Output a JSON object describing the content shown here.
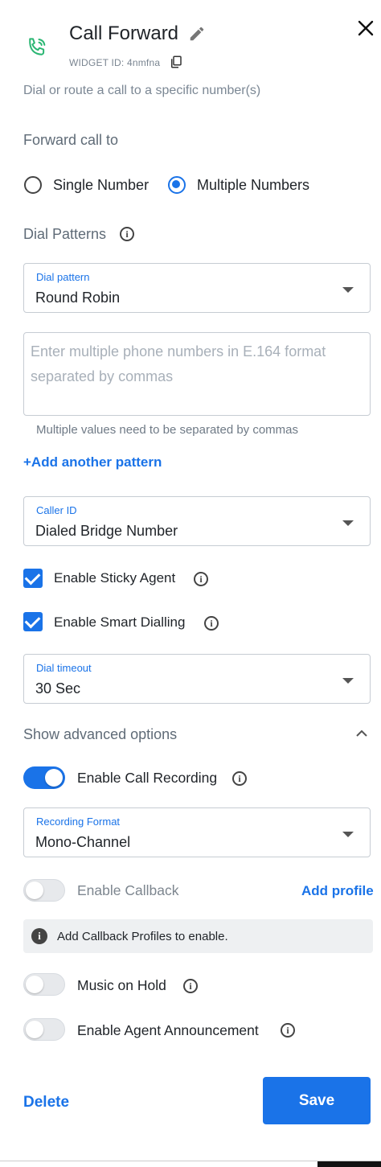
{
  "header": {
    "title": "Call Forward",
    "widget_id": "WIDGET ID: 4nmfna",
    "description": "Dial or route a call to a specific number(s)"
  },
  "forward": {
    "heading": "Forward call to",
    "options": [
      "Single Number",
      "Multiple Numbers"
    ],
    "selected": "Multiple Numbers"
  },
  "dial_patterns": {
    "heading": "Dial Patterns",
    "pattern_label": "Dial pattern",
    "pattern_value": "Round Robin",
    "numbers_placeholder": "Enter multiple phone numbers in E.164 format separated by commas",
    "helper": "Multiple values need to be separated by commas",
    "add_link": "+Add another pattern"
  },
  "caller_id": {
    "label": "Caller ID",
    "value": "Dialed Bridge Number"
  },
  "checkboxes": {
    "sticky_agent": {
      "label": "Enable Sticky Agent",
      "checked": true
    },
    "smart_dialling": {
      "label": "Enable Smart Dialling",
      "checked": true
    }
  },
  "dial_timeout": {
    "label": "Dial timeout",
    "value": "30 Sec"
  },
  "advanced": {
    "heading": "Show advanced options",
    "call_recording": {
      "label": "Enable Call Recording",
      "on": true
    },
    "recording_format": {
      "label": "Recording Format",
      "value": "Mono-Channel"
    },
    "callback": {
      "label": "Enable Callback",
      "on": false,
      "link": "Add profile"
    },
    "callback_note": "Add Callback Profiles to enable.",
    "music_on_hold": {
      "label": "Music on Hold",
      "on": false
    },
    "agent_announcement": {
      "label": "Enable Agent Announcement",
      "on": false
    }
  },
  "footer": {
    "delete_label": "Delete",
    "save_label": "Save"
  },
  "colors": {
    "accent": "#1a73e8",
    "phone_icon": "#2bb673"
  }
}
